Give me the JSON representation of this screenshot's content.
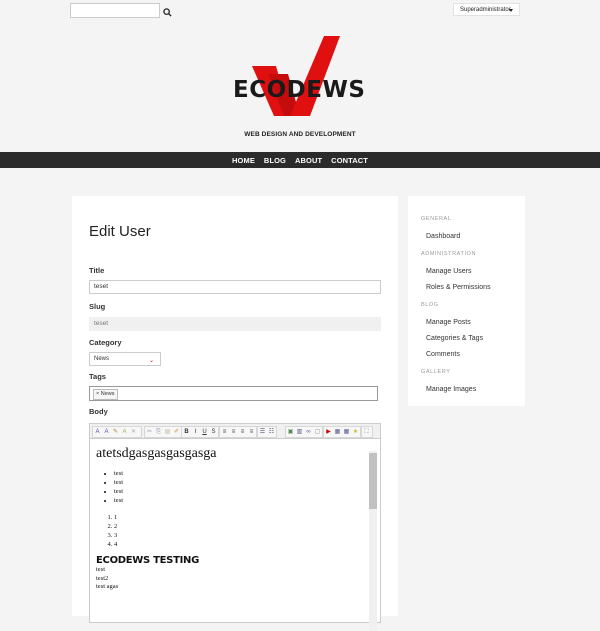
{
  "topbar": {
    "search_placeholder": "",
    "search_icon": "search-icon",
    "user_label": "Superadministrator"
  },
  "brand": {
    "logo_text": "ECODEWS",
    "tagline": "WEB DESIGN AND DEVELOPMENT",
    "logo_color": "#e01010"
  },
  "nav": {
    "items": [
      "HOME",
      "BLOG",
      "ABOUT",
      "CONTACT"
    ]
  },
  "form": {
    "title": "Edit User",
    "title_label": "Title",
    "title_value": "teset",
    "slug_label": "Slug",
    "slug_value": "teset",
    "category_label": "Category",
    "category_value": "News",
    "tags_label": "Tags",
    "tag_chip": "× News",
    "body_label": "Body"
  },
  "editor": {
    "heading": "atetsdgasgasgasgasga",
    "bullets": [
      "test",
      "test",
      "test",
      "test"
    ],
    "numbered": [
      "1",
      "2",
      "3",
      "4"
    ],
    "subheading": "ECODEWS TESTING",
    "lines": [
      "test",
      "test2",
      "test agas"
    ]
  },
  "sidebar": {
    "sections": [
      {
        "title": "GENERAL",
        "items": [
          "Dashboard"
        ]
      },
      {
        "title": "ADMINISTRATION",
        "items": [
          "Manage Users",
          "Roles & Permissions"
        ]
      },
      {
        "title": "BLOG",
        "items": [
          "Manage Posts",
          "Categories & Tags",
          "Comments"
        ]
      },
      {
        "title": "GALLERY",
        "items": [
          "Manage Images"
        ]
      }
    ]
  },
  "colors": {
    "navbar_bg": "#2b2b2b",
    "page_bg": "#f4f4f5",
    "accent": "#e01010"
  }
}
